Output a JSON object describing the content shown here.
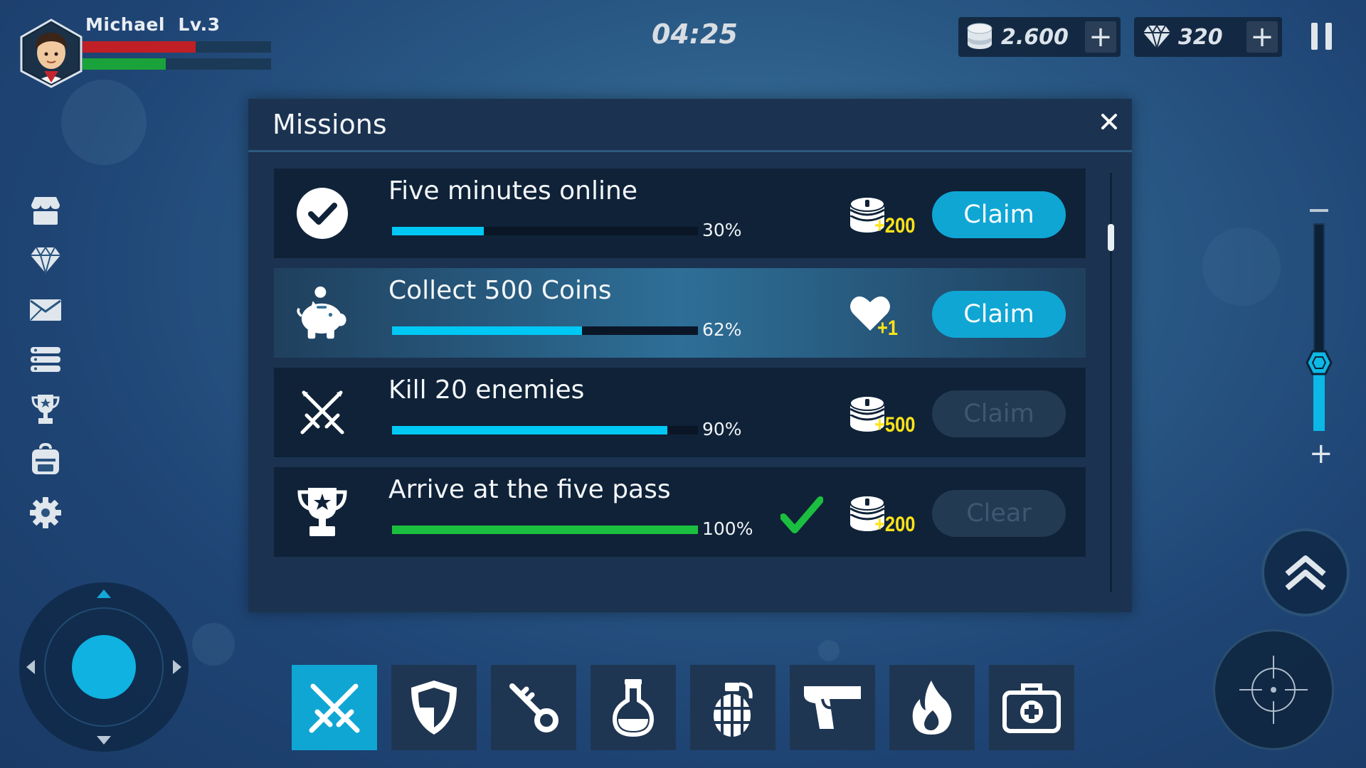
{
  "hud": {
    "player_name": "Michael",
    "level": "Lv.3",
    "health": 0.6,
    "energy": 0.44,
    "timer": "04:25",
    "coins": "2.600",
    "coins_plus": "+",
    "gems": "320",
    "gems_plus": "+"
  },
  "sidebar": {
    "icons": [
      "shop-icon",
      "diamond-icon",
      "mail-icon",
      "list-icon",
      "trophy-icon",
      "backpack-icon",
      "gear-icon"
    ]
  },
  "missions_dialog": {
    "title": "Missions",
    "close_label": "✕",
    "items": [
      {
        "icon": "check-circle-icon",
        "title": "Five minutes online",
        "progress": 0.3,
        "progress_label": "30%",
        "reward_icon": "coin-stack-icon",
        "reward": "+200",
        "completed_mark": false,
        "button": "Claim",
        "button_enabled": true
      },
      {
        "icon": "piggy-bank-icon",
        "title": "Collect 500 Coins",
        "progress": 0.62,
        "progress_label": "62%",
        "reward_icon": "heart-icon",
        "reward": "+1",
        "completed_mark": false,
        "button": "Claim",
        "button_enabled": true
      },
      {
        "icon": "crossed-swords-icon",
        "title": "Kill 20 enemies",
        "progress": 0.9,
        "progress_label": "90%",
        "reward_icon": "coin-stack-icon",
        "reward": "+500",
        "completed_mark": false,
        "button": "Claim",
        "button_enabled": false
      },
      {
        "icon": "trophy-icon",
        "title": "Arrive at the five pass",
        "progress": 1.0,
        "progress_label": "100%",
        "reward_icon": "coin-stack-icon",
        "reward": "+200",
        "completed_mark": true,
        "button": "Clear",
        "button_enabled": false
      }
    ]
  },
  "zoom": {
    "minus": "−",
    "plus": "+",
    "level": 0.33
  },
  "item_bar": {
    "slots": [
      "swords-icon",
      "shield-icon",
      "key-icon",
      "potion-icon",
      "grenade-icon",
      "pistol-icon",
      "fire-icon",
      "medkit-icon"
    ],
    "active_index": 0
  },
  "colors": {
    "accent": "#0fa6d4",
    "progress": "#00c8f5",
    "complete": "#1bbf3f",
    "health": "#c01f26",
    "energy": "#1aa33a",
    "reward_text": "#ffe318"
  }
}
